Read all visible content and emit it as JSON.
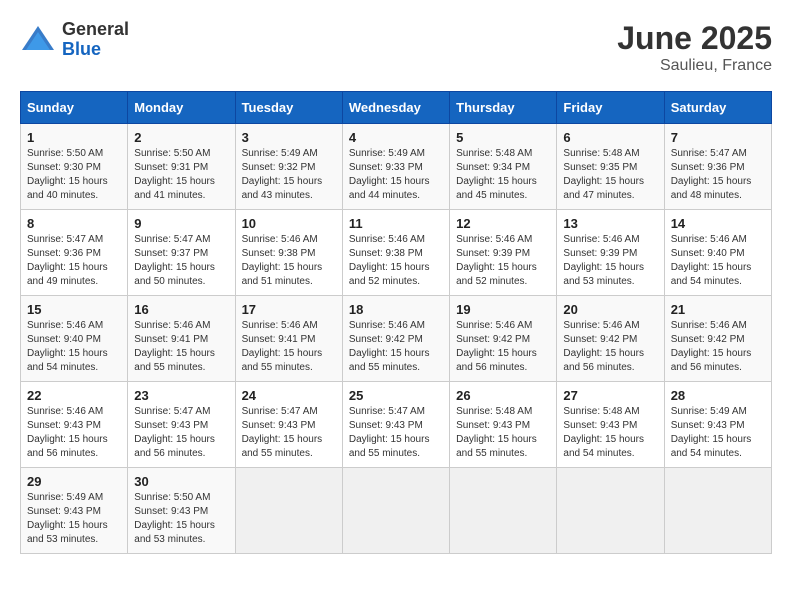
{
  "header": {
    "logo": {
      "general": "General",
      "blue": "Blue"
    },
    "title": "June 2025",
    "location": "Saulieu, France"
  },
  "calendar": {
    "days_of_week": [
      "Sunday",
      "Monday",
      "Tuesday",
      "Wednesday",
      "Thursday",
      "Friday",
      "Saturday"
    ],
    "weeks": [
      [
        null,
        {
          "day": 2,
          "sunrise": "5:50 AM",
          "sunset": "9:31 PM",
          "daylight": "15 hours and 41 minutes."
        },
        {
          "day": 3,
          "sunrise": "5:49 AM",
          "sunset": "9:32 PM",
          "daylight": "15 hours and 43 minutes."
        },
        {
          "day": 4,
          "sunrise": "5:49 AM",
          "sunset": "9:33 PM",
          "daylight": "15 hours and 44 minutes."
        },
        {
          "day": 5,
          "sunrise": "5:48 AM",
          "sunset": "9:34 PM",
          "daylight": "15 hours and 45 minutes."
        },
        {
          "day": 6,
          "sunrise": "5:48 AM",
          "sunset": "9:35 PM",
          "daylight": "15 hours and 47 minutes."
        },
        {
          "day": 7,
          "sunrise": "5:47 AM",
          "sunset": "9:36 PM",
          "daylight": "15 hours and 48 minutes."
        }
      ],
      [
        {
          "day": 8,
          "sunrise": "5:47 AM",
          "sunset": "9:36 PM",
          "daylight": "15 hours and 49 minutes."
        },
        {
          "day": 9,
          "sunrise": "5:47 AM",
          "sunset": "9:37 PM",
          "daylight": "15 hours and 50 minutes."
        },
        {
          "day": 10,
          "sunrise": "5:46 AM",
          "sunset": "9:38 PM",
          "daylight": "15 hours and 51 minutes."
        },
        {
          "day": 11,
          "sunrise": "5:46 AM",
          "sunset": "9:38 PM",
          "daylight": "15 hours and 52 minutes."
        },
        {
          "day": 12,
          "sunrise": "5:46 AM",
          "sunset": "9:39 PM",
          "daylight": "15 hours and 52 minutes."
        },
        {
          "day": 13,
          "sunrise": "5:46 AM",
          "sunset": "9:39 PM",
          "daylight": "15 hours and 53 minutes."
        },
        {
          "day": 14,
          "sunrise": "5:46 AM",
          "sunset": "9:40 PM",
          "daylight": "15 hours and 54 minutes."
        }
      ],
      [
        {
          "day": 15,
          "sunrise": "5:46 AM",
          "sunset": "9:40 PM",
          "daylight": "15 hours and 54 minutes."
        },
        {
          "day": 16,
          "sunrise": "5:46 AM",
          "sunset": "9:41 PM",
          "daylight": "15 hours and 55 minutes."
        },
        {
          "day": 17,
          "sunrise": "5:46 AM",
          "sunset": "9:41 PM",
          "daylight": "15 hours and 55 minutes."
        },
        {
          "day": 18,
          "sunrise": "5:46 AM",
          "sunset": "9:42 PM",
          "daylight": "15 hours and 55 minutes."
        },
        {
          "day": 19,
          "sunrise": "5:46 AM",
          "sunset": "9:42 PM",
          "daylight": "15 hours and 56 minutes."
        },
        {
          "day": 20,
          "sunrise": "5:46 AM",
          "sunset": "9:42 PM",
          "daylight": "15 hours and 56 minutes."
        },
        {
          "day": 21,
          "sunrise": "5:46 AM",
          "sunset": "9:42 PM",
          "daylight": "15 hours and 56 minutes."
        }
      ],
      [
        {
          "day": 22,
          "sunrise": "5:46 AM",
          "sunset": "9:43 PM",
          "daylight": "15 hours and 56 minutes."
        },
        {
          "day": 23,
          "sunrise": "5:47 AM",
          "sunset": "9:43 PM",
          "daylight": "15 hours and 56 minutes."
        },
        {
          "day": 24,
          "sunrise": "5:47 AM",
          "sunset": "9:43 PM",
          "daylight": "15 hours and 55 minutes."
        },
        {
          "day": 25,
          "sunrise": "5:47 AM",
          "sunset": "9:43 PM",
          "daylight": "15 hours and 55 minutes."
        },
        {
          "day": 26,
          "sunrise": "5:48 AM",
          "sunset": "9:43 PM",
          "daylight": "15 hours and 55 minutes."
        },
        {
          "day": 27,
          "sunrise": "5:48 AM",
          "sunset": "9:43 PM",
          "daylight": "15 hours and 54 minutes."
        },
        {
          "day": 28,
          "sunrise": "5:49 AM",
          "sunset": "9:43 PM",
          "daylight": "15 hours and 54 minutes."
        }
      ],
      [
        {
          "day": 29,
          "sunrise": "5:49 AM",
          "sunset": "9:43 PM",
          "daylight": "15 hours and 53 minutes."
        },
        {
          "day": 30,
          "sunrise": "5:50 AM",
          "sunset": "9:43 PM",
          "daylight": "15 hours and 53 minutes."
        },
        null,
        null,
        null,
        null,
        null
      ]
    ],
    "week1_day1": {
      "day": 1,
      "sunrise": "5:50 AM",
      "sunset": "9:30 PM",
      "daylight": "15 hours and 40 minutes."
    }
  }
}
